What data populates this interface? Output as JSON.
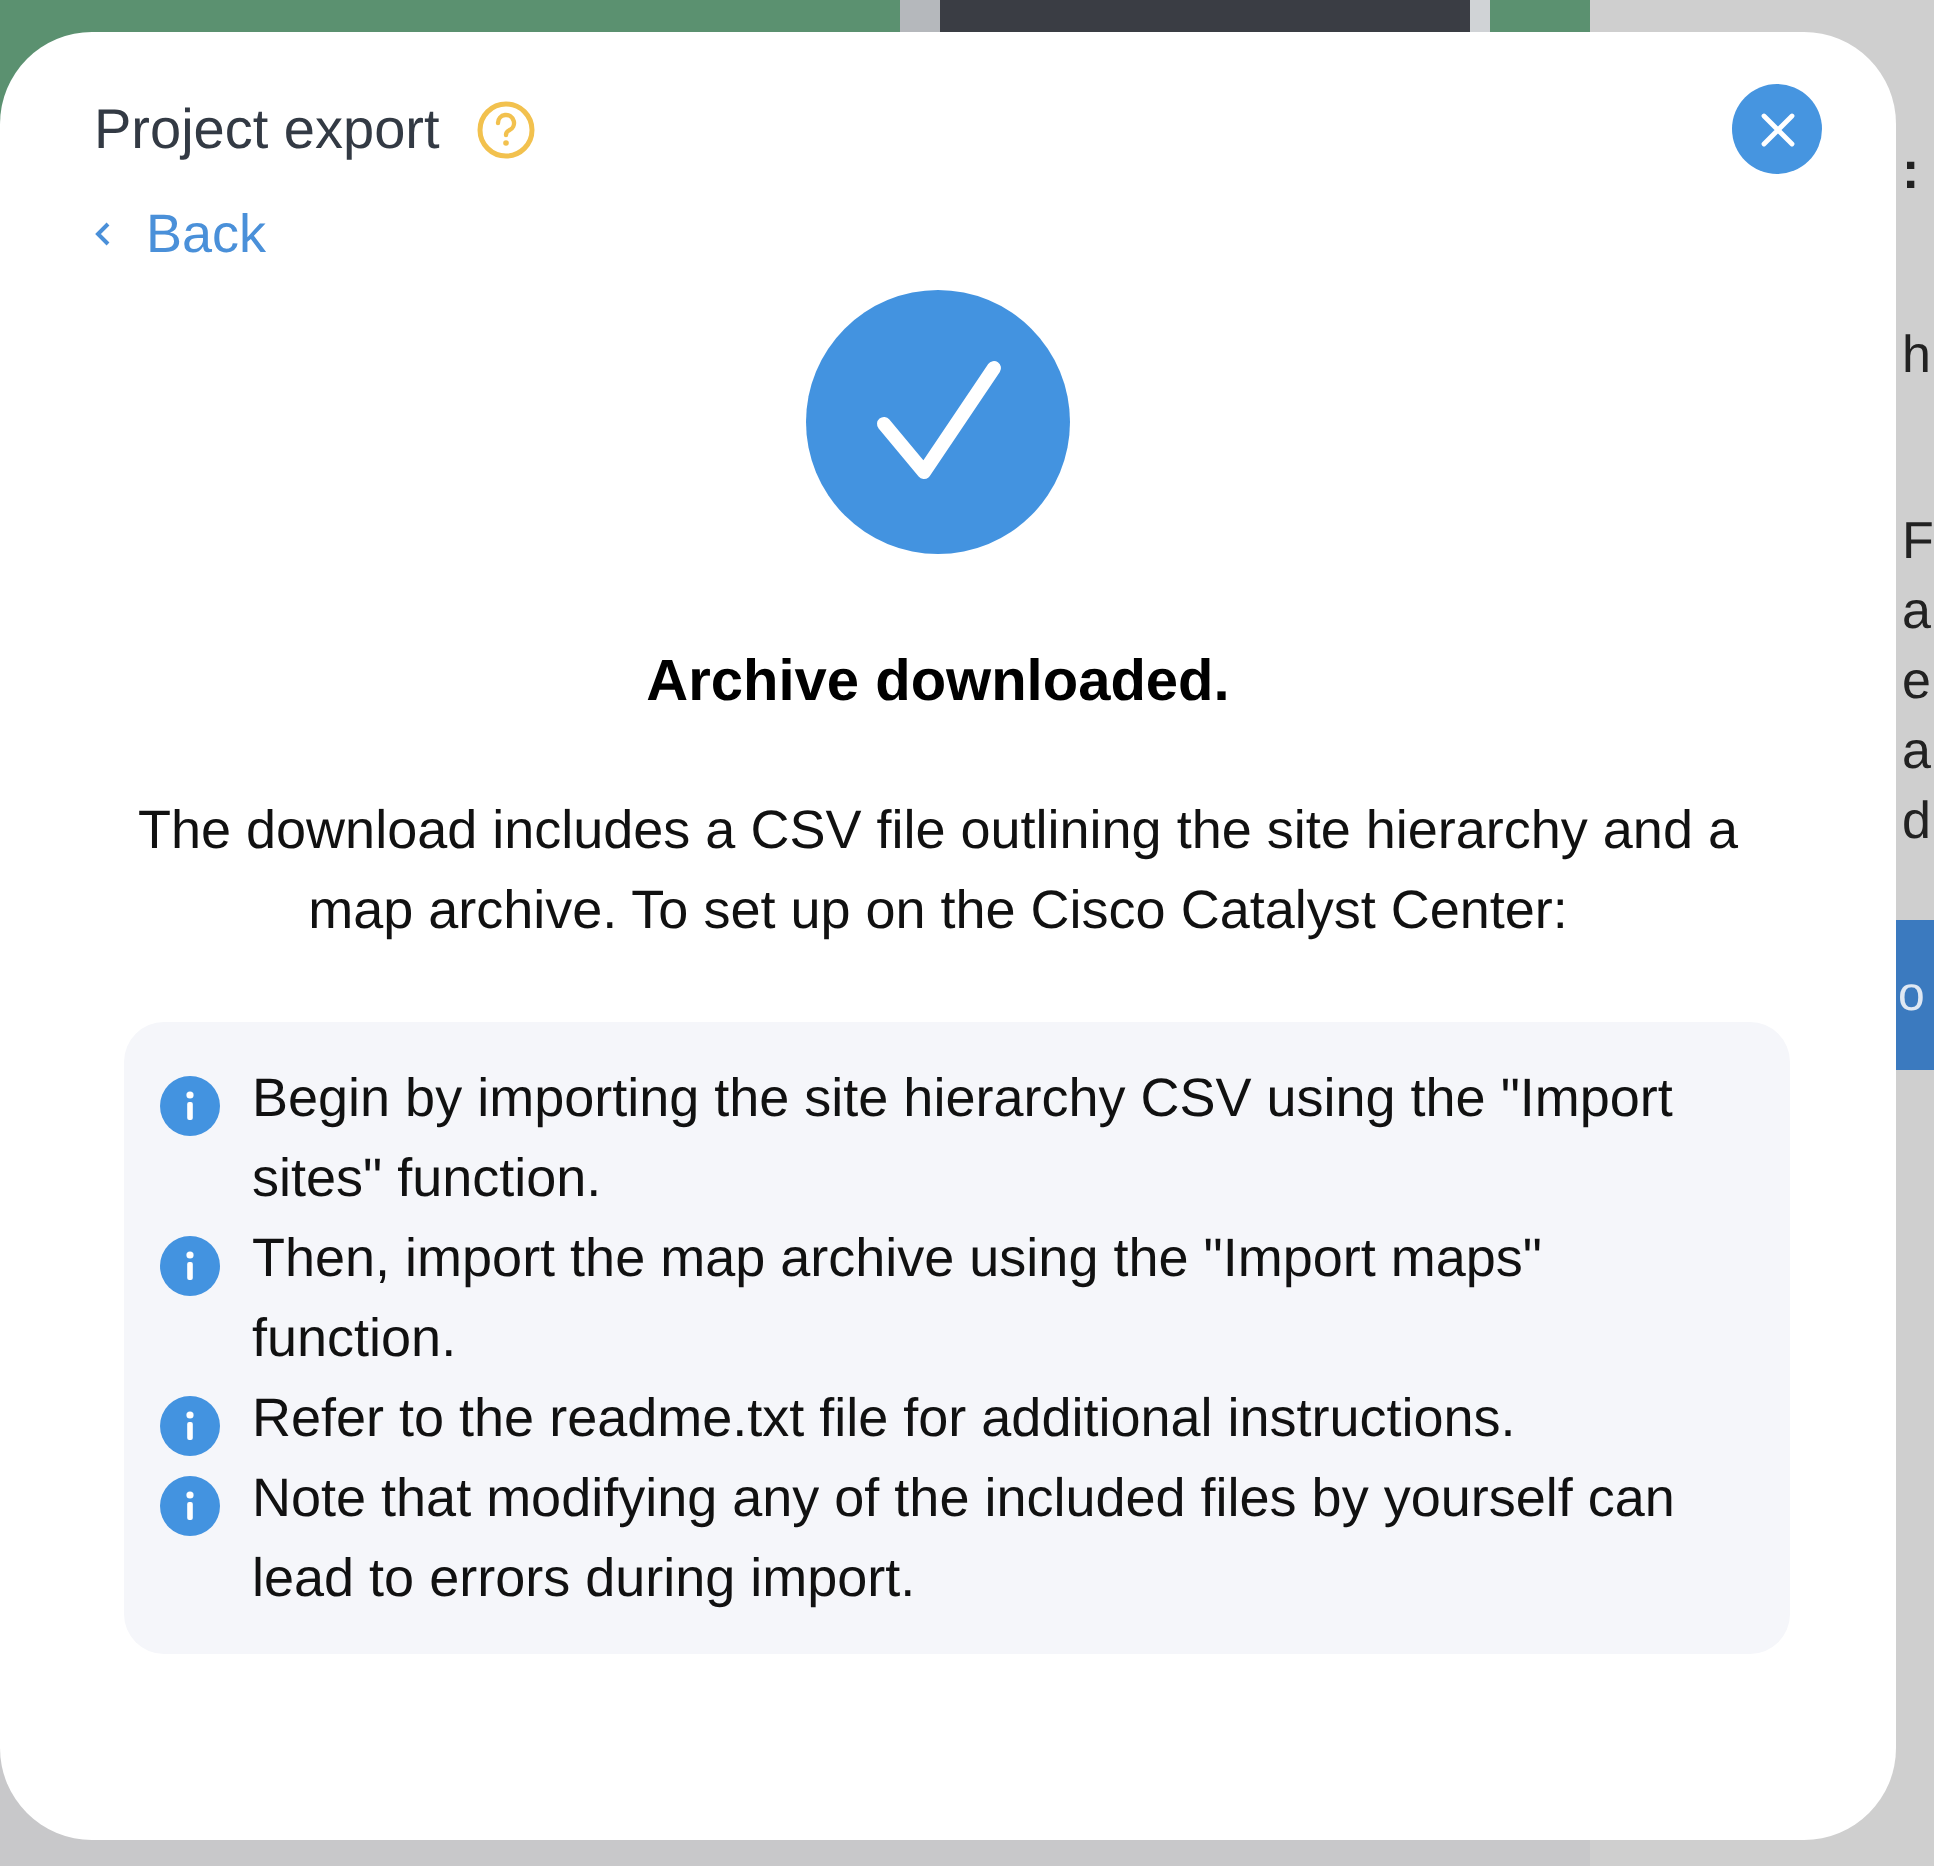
{
  "background": {
    "side_panel_title": ":",
    "side_panel_lines": [
      "h",
      "F",
      "a",
      "e",
      "a",
      "d"
    ],
    "side_button": "o"
  },
  "dialog": {
    "title": "Project export",
    "back": "Back",
    "heading": "Archive downloaded.",
    "message": "The download includes a CSV file outlining the site hierarchy and a map archive. To set up on the Cisco Catalyst Center:",
    "notes": [
      "Begin by importing the site hierarchy CSV using the \"Import sites\" function.",
      "Then, import the map archive using the \"Import maps\" function.",
      "Refer to the readme.txt file for additional instructions.",
      "Note that modifying any of the included files by yourself can lead to errors during import."
    ]
  }
}
